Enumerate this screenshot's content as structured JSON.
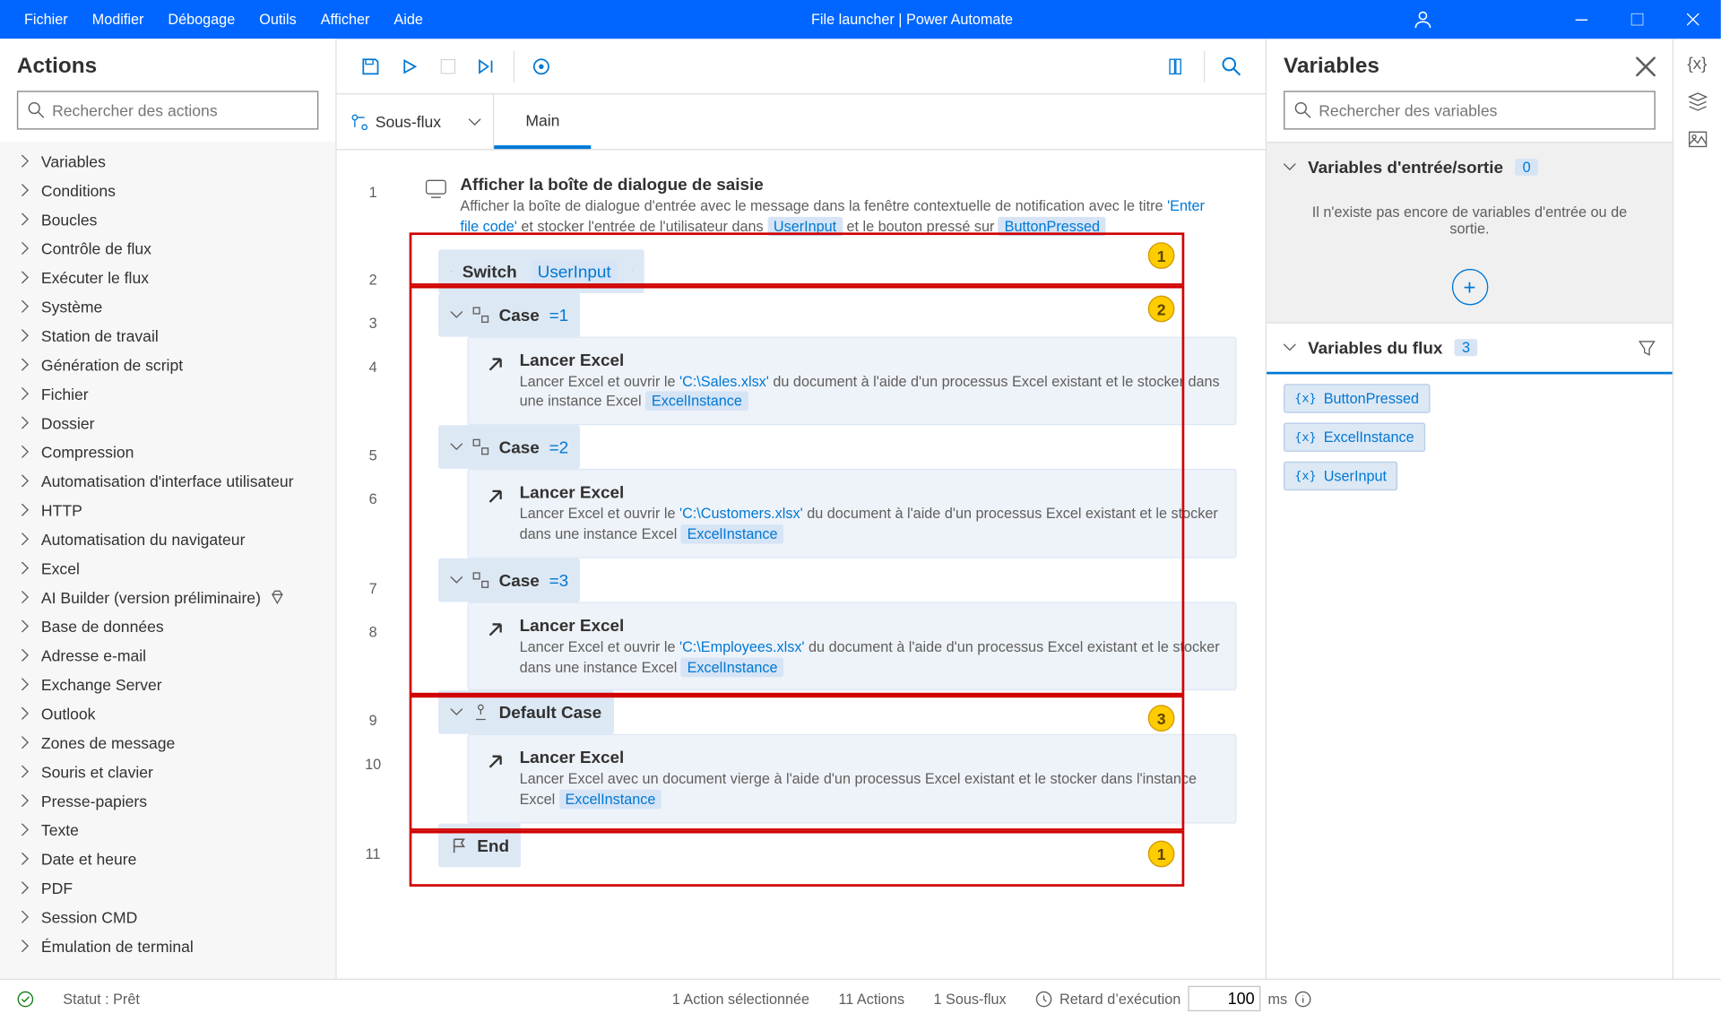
{
  "title": "File launcher | Power Automate",
  "menus": [
    "Fichier",
    "Modifier",
    "Débogage",
    "Outils",
    "Afficher",
    "Aide"
  ],
  "leftPanel": {
    "heading": "Actions",
    "searchPlaceholder": "Rechercher des actions",
    "categories": [
      "Variables",
      "Conditions",
      "Boucles",
      "Contrôle de flux",
      "Exécuter le flux",
      "Système",
      "Station de travail",
      "Génération de script",
      "Fichier",
      "Dossier",
      "Compression",
      "Automatisation d'interface utilisateur",
      "HTTP",
      "Automatisation du navigateur",
      "Excel",
      "AI Builder (version préliminaire)",
      "Base de données",
      "Adresse e-mail",
      "Exchange Server",
      "Outlook",
      "Zones de message",
      "Souris et clavier",
      "Presse-papiers",
      "Texte",
      "Date et heure",
      "PDF",
      "Session CMD",
      "Émulation de terminal"
    ]
  },
  "subflow": {
    "label": "Sous-flux",
    "tab": "Main"
  },
  "flow": {
    "step1": {
      "name": "Afficher la boîte de dialogue de saisie",
      "d1": "Afficher la boîte de dialogue d'entrée avec le message  dans la fenêtre contextuelle de notification avec le titre ",
      "s1": "'Enter file code'",
      "d2": " et stocker l'entrée de l'utilisateur dans ",
      "v1": "UserInput",
      "d3": " et le bouton pressé sur ",
      "v2": "ButtonPressed"
    },
    "switch": {
      "label": "Switch",
      "var": "UserInput"
    },
    "case1": {
      "label": "Case",
      "val": "=1"
    },
    "case2": {
      "label": "Case",
      "val": "=2"
    },
    "case3": {
      "label": "Case",
      "val": "=3"
    },
    "defcase": {
      "label": "Default Case"
    },
    "launch": {
      "name": "Lancer Excel",
      "d_pre": "Lancer Excel et ouvrir le ",
      "d_mid": " du document à l'aide d'un processus Excel existant et le stocker dans une instance Excel ",
      "d_blank": "Lancer Excel avec un document vierge à l'aide d'un processus Excel existant et le stocker dans l'instance Excel ",
      "f1": "'C:\\Sales.xlsx'",
      "f2": "'C:\\Customers.xlsx'",
      "f3": "'C:\\Employees.xlsx'",
      "v": "ExcelInstance"
    },
    "end": "End"
  },
  "rightPanel": {
    "heading": "Variables",
    "searchPlaceholder": "Rechercher des variables",
    "ioHead": "Variables d'entrée/sortie",
    "ioCount": "0",
    "ioEmpty": "Il n'existe pas encore de variables d'entrée ou de sortie.",
    "flowHead": "Variables du flux",
    "flowCount": "3",
    "vars": [
      "ButtonPressed",
      "ExcelInstance",
      "UserInput"
    ]
  },
  "status": {
    "state": "Statut : Prêt",
    "sel": "1 Action sélectionnée",
    "act": "11 Actions",
    "sf": "1 Sous-flux",
    "delay": "Retard d’exécution",
    "delayVal": "100",
    "ms": "ms"
  }
}
